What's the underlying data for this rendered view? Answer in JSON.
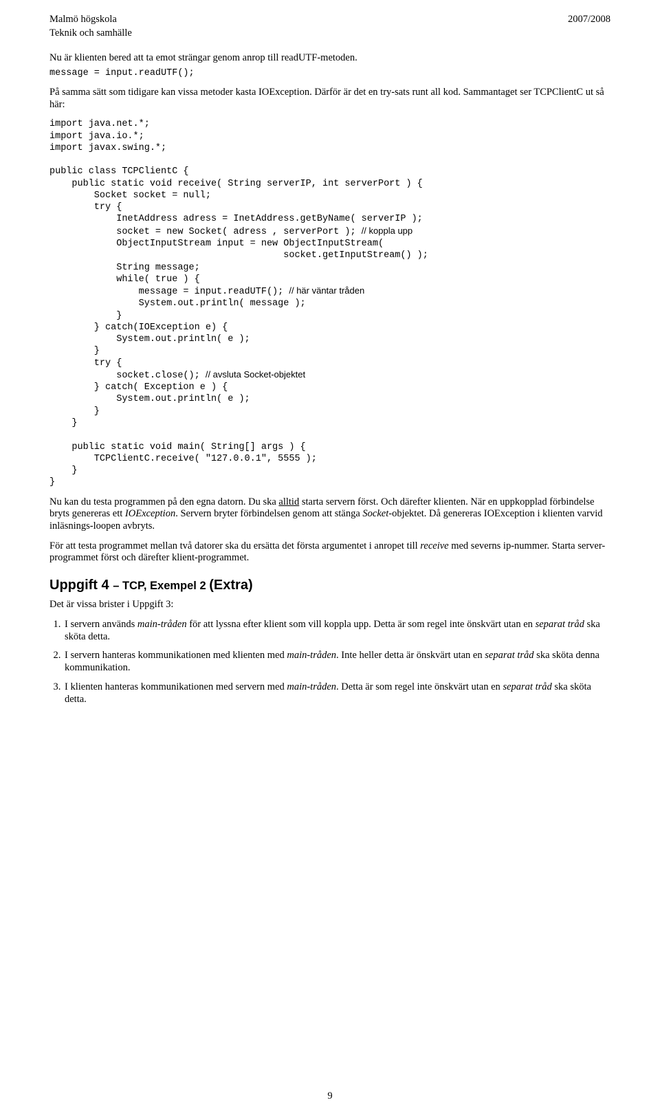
{
  "header": {
    "left1": "Malmö högskola",
    "left2": "Teknik och samhälle",
    "right": "2007/2008"
  },
  "p1a": "Nu är klienten bered att ta emot strängar genom anrop till readUTF-metoden.",
  "p1_code": "message = input.readUTF();",
  "p2": "På samma sätt som tidigare kan vissa metoder kasta IOException. Därför är det en try-sats runt all kod. Sammantaget ser TCPClientC ut så här:",
  "code_block": {
    "l01": "import java.net.*;",
    "l02": "import java.io.*;",
    "l03": "import javax.swing.*;",
    "l04": "",
    "l05": "public class TCPClientC {",
    "l06": "    public static void receive( String serverIP, int serverPort ) {",
    "l07": "        Socket socket = null;",
    "l08": "        try {",
    "l09": "            InetAddress adress = InetAddress.getByName( serverIP );",
    "l10a": "            socket = new Socket( adress , serverPort ); ",
    "l10b": "// koppla upp",
    "l11": "            ObjectInputStream input = new ObjectInputStream(",
    "l12": "                                          socket.getInputStream() );",
    "l13": "            String message;",
    "l14": "            while( true ) {",
    "l15a": "                message = input.readUTF(); ",
    "l15b": "// här väntar tråden",
    "l16": "                System.out.println( message );",
    "l17": "            }",
    "l18": "        } catch(IOException e) {",
    "l19": "            System.out.println( e );",
    "l20": "        }",
    "l21": "        try {",
    "l22a": "            socket.close(); ",
    "l22b": "// avsluta Socket-objektet",
    "l23": "        } catch( Exception e ) {",
    "l24": "            System.out.println( e );",
    "l25": "        }",
    "l26": "    }",
    "l27": "",
    "l28": "    public static void main( String[] args ) {",
    "l29": "        TCPClientC.receive( \"127.0.0.1\", 5555 );",
    "l30": "    }",
    "l31": "}"
  },
  "p3_a": "Nu kan du testa programmen på den egna datorn. Du ska ",
  "p3_b": "alltid",
  "p3_c": " starta servern först. Och därefter klienten. När en uppkopplad förbindelse bryts genereras ett ",
  "p3_d": "IOException",
  "p3_e": ". Servern bryter förbindelsen genom att stänga ",
  "p3_f": "Socket",
  "p3_g": "-objektet. Då genereras IOException i klienten varvid inläsnings-loopen avbryts.",
  "p4_a": "För att testa programmet mellan två datorer ska du ersätta det första argumentet i anropet till ",
  "p4_b": "receive",
  "p4_c": " med severns ip-nummer. Starta server-programmet först och därefter klient-programmet.",
  "h2a": "Uppgift 4 ",
  "h2b": "– TCP, Exempel 2 ",
  "h2c": "(Extra)",
  "p5": "Det är vissa brister i Uppgift 3:",
  "li1_a": "I servern används ",
  "li1_b": "main-tråden",
  "li1_c": " för att lyssna efter klient som vill koppla upp. Detta är som regel inte önskvärt utan en ",
  "li1_d": "separat tråd",
  "li1_e": " ska sköta detta.",
  "li2_a": "I servern hanteras kommunikationen med klienten med ",
  "li2_b": "main-tråden",
  "li2_c": ". Inte heller detta är önskvärt utan en ",
  "li2_d": "separat tråd",
  "li2_e": " ska sköta denna kommunikation.",
  "li3_a": "I klienten hanteras kommunikationen med servern med ",
  "li3_b": "main-tråden",
  "li3_c": ". Detta är som regel inte önskvärt utan en ",
  "li3_d": "separat tråd",
  "li3_e": " ska sköta detta.",
  "pagenum": "9"
}
